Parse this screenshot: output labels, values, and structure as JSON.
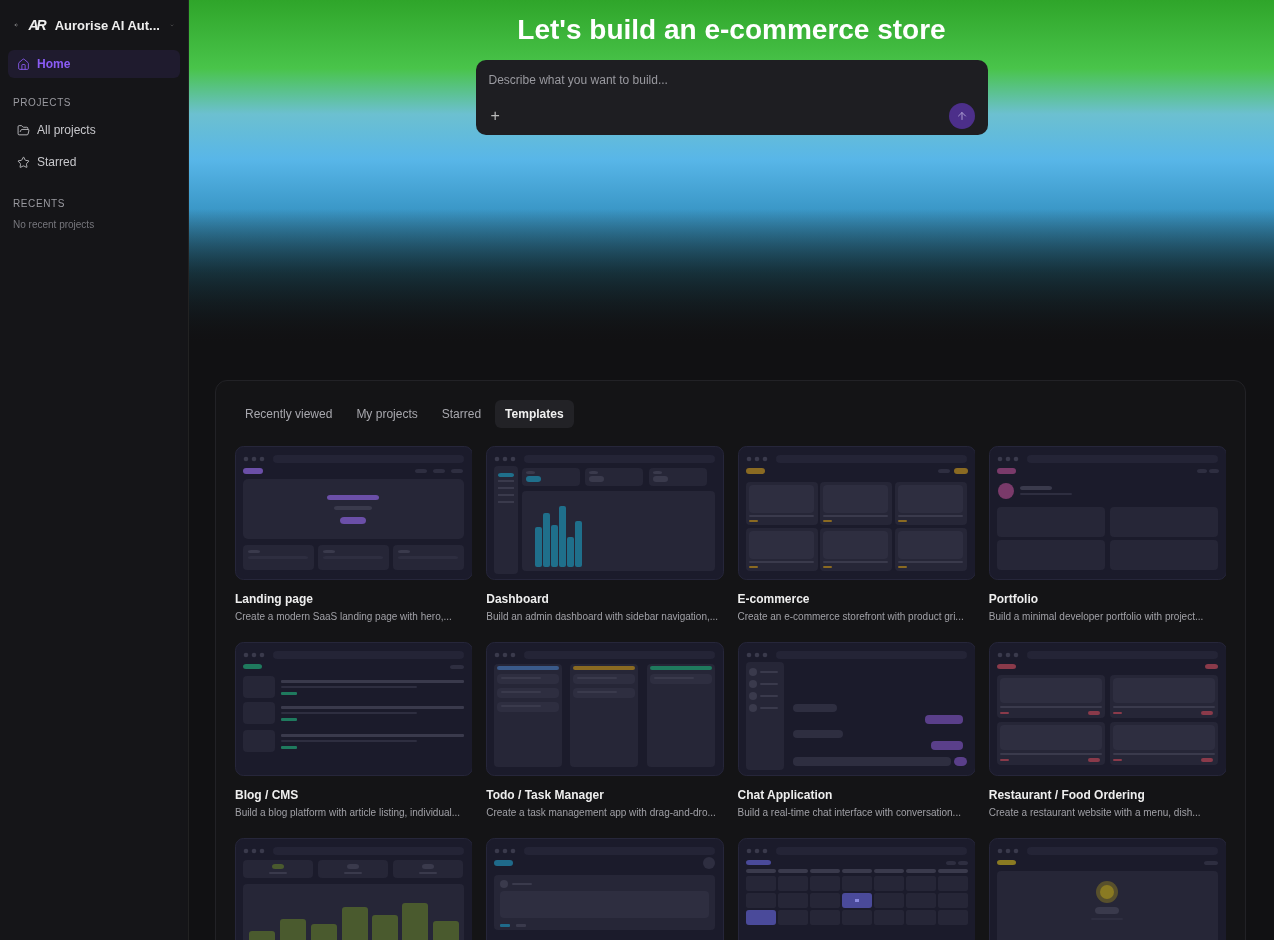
{
  "sidebar": {
    "workspace": "Aurorise AI Aut...",
    "logo": "AR",
    "nav": [
      {
        "label": "Home",
        "selected": true
      }
    ],
    "projects_heading": "PROJECTS",
    "projects": [
      {
        "label": "All projects",
        "selected": false
      },
      {
        "label": "Starred",
        "selected": false
      }
    ],
    "recents_heading": "RECENTS",
    "recents_empty": "No recent projects"
  },
  "hero": {
    "title": "Let's build an e-commerce store",
    "prompt": {
      "placeholder": "Describe what you want to build...",
      "attach": "+"
    }
  },
  "tabs": [
    {
      "label": "Recently viewed",
      "selected": false
    },
    {
      "label": "My projects",
      "selected": false
    },
    {
      "label": "Starred",
      "selected": false
    },
    {
      "label": "Templates",
      "selected": true
    }
  ],
  "templates": [
    {
      "kind": "landing",
      "color": "#6b4fa8",
      "title": "Landing page",
      "description": "Create a modern SaaS landing page with hero,..."
    },
    {
      "kind": "dashboard",
      "color": "#1f6f8b",
      "title": "Dashboard",
      "description": "Build an admin dashboard with sidebar navigation,..."
    },
    {
      "kind": "ecommerce",
      "color": "#8a6a22",
      "title": "E-commerce",
      "description": "Create an e-commerce storefront with product gri..."
    },
    {
      "kind": "portfolio",
      "color": "#7a3a6a",
      "title": "Portfolio",
      "description": "Build a minimal developer portfolio with project..."
    },
    {
      "kind": "blog",
      "color": "#1f7a5e",
      "title": "Blog / CMS",
      "description": "Build a blog platform with article listing, individual..."
    },
    {
      "kind": "kanban",
      "color": "#3a5a8a",
      "title": "Todo / Task Manager",
      "description": "Create a task management app with drag-and-dro..."
    },
    {
      "kind": "chat",
      "color": "#5a3f8a",
      "title": "Chat Application",
      "description": "Build a real-time chat interface with conversation..."
    },
    {
      "kind": "restaurant",
      "color": "#8a3a4a",
      "title": "Restaurant / Food Ordering",
      "description": "Create a restaurant website with a menu, dish..."
    },
    {
      "kind": "analytics",
      "color": "#4a5a2e"
    },
    {
      "kind": "social",
      "color": "#1f6a8a"
    },
    {
      "kind": "calendar",
      "color": "#4a4a9a"
    },
    {
      "kind": "profile",
      "color": "#8a7a22"
    }
  ]
}
